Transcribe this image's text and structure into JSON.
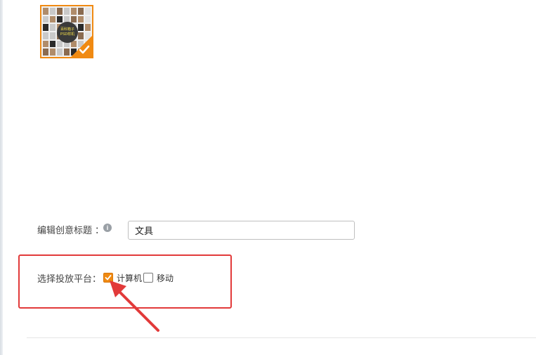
{
  "thumbnail": {
    "badge_line1": "百科箱子",
    "badge_line2": "PSD样机",
    "selected": true
  },
  "form": {
    "title_label": "编辑创意标题",
    "title_colon": "：",
    "title_info_icon": "info-icon",
    "title_value": "文具",
    "platform_label": "选择投放平台："
  },
  "platforms": [
    {
      "label": "计算机",
      "checked": true
    },
    {
      "label": "移动",
      "checked": false
    }
  ],
  "colors": {
    "accent_orange": "#f08a12",
    "highlight_red": "#e23a3a"
  }
}
